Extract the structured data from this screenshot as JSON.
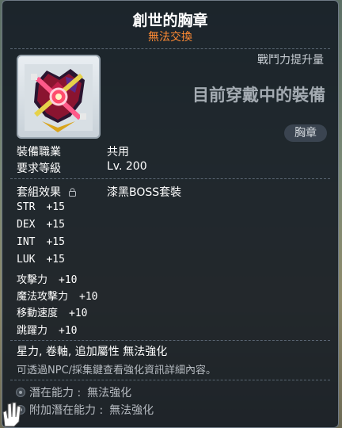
{
  "item": {
    "name": "創世的胸章",
    "trade": "無法交換",
    "power_label": "戰鬥力提升量",
    "equipped_label": "目前穿戴中的裝備",
    "type_badge": "胸章"
  },
  "requirements": [
    {
      "label": "裝備職業",
      "value": "共用"
    },
    {
      "label": "要求等級",
      "value": "Lv. 200"
    }
  ],
  "set_effect": {
    "label": "套組效果",
    "value": "漆黑BOSS套裝"
  },
  "stats": [
    {
      "name": "STR",
      "value": "+15"
    },
    {
      "name": "DEX",
      "value": "+15"
    },
    {
      "name": "INT",
      "value": "+15"
    },
    {
      "name": "LUK",
      "value": "+15"
    },
    {
      "name": "攻擊力",
      "value": "+10"
    },
    {
      "name": "魔法攻擊力",
      "value": "+10"
    },
    {
      "name": "移動速度",
      "value": "+10"
    },
    {
      "name": "跳躍力",
      "value": "+10"
    }
  ],
  "upgrade_note": "星力, 卷軸, 追加屬性 無法強化",
  "info_note": "可透過NPC/採集鍵查看強化資訊詳細內容。",
  "potential": {
    "label": "潛在能力 :",
    "value": "無法強化"
  },
  "additional_potential": {
    "label": "附加潛在能力 :",
    "value": "無法強化"
  },
  "colors": {
    "trade": "#ff8a33",
    "title": "#ffffff",
    "muted": "#b7bcc2"
  },
  "icons": [
    "emblem-icon",
    "lock-icon",
    "potential-dot-icon",
    "glove-cursor-icon"
  ]
}
